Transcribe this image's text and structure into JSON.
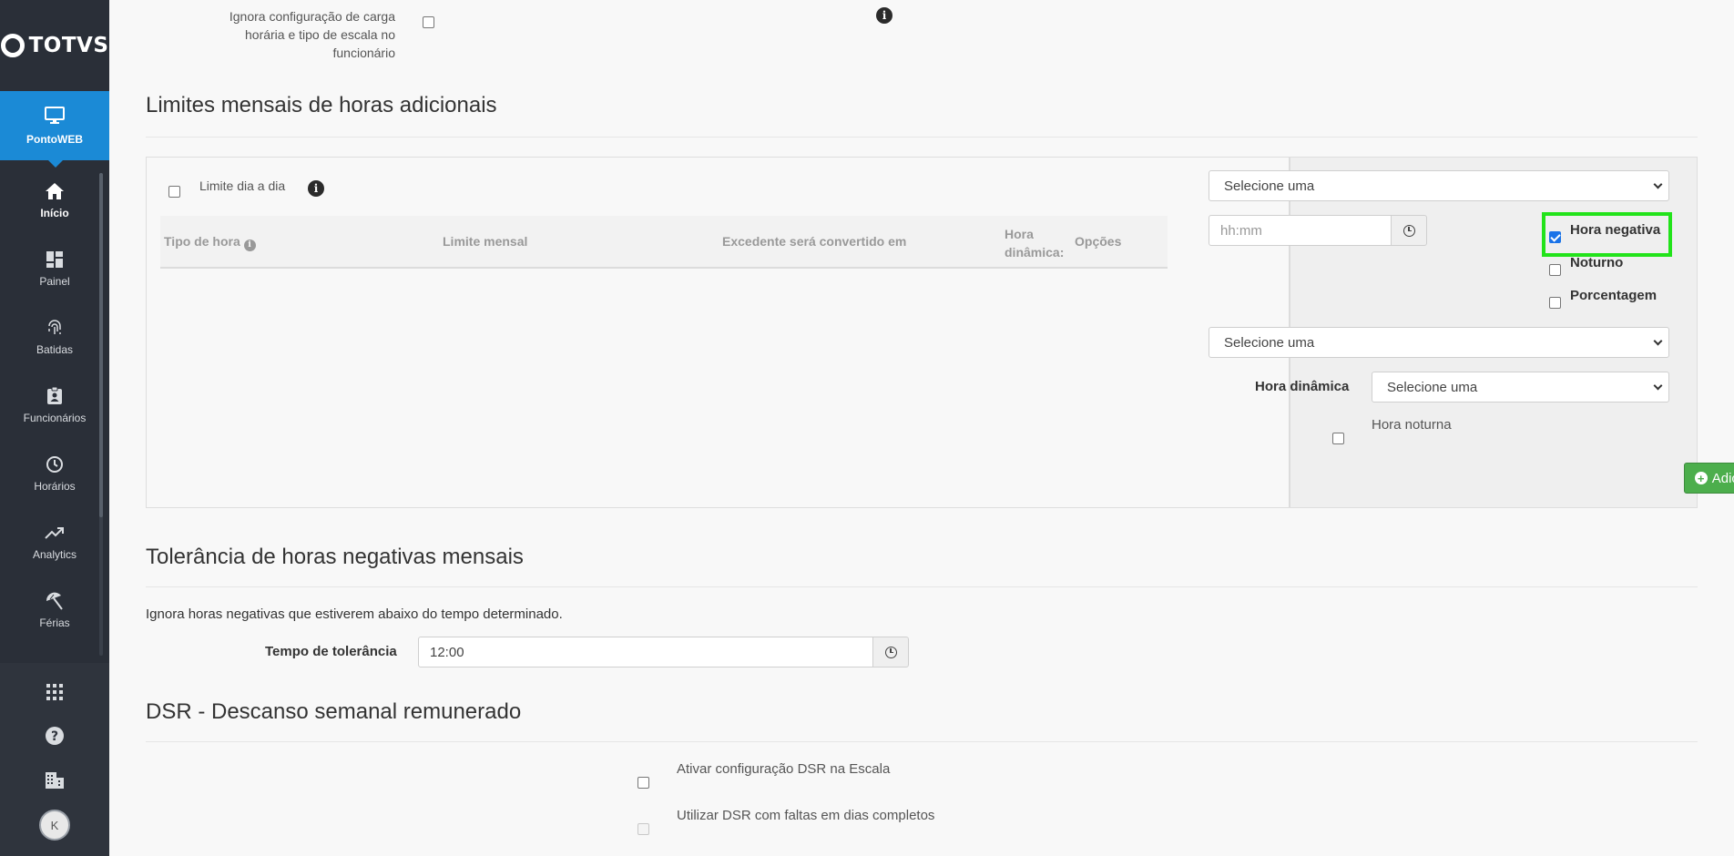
{
  "brand": {
    "logo_text": "TOTVS"
  },
  "sidebar": {
    "module": {
      "label": "PontoWEB",
      "icon": "monitor-icon"
    },
    "items": [
      {
        "label": "Início",
        "icon": "home-icon"
      },
      {
        "label": "Painel",
        "icon": "dashboard-icon"
      },
      {
        "label": "Batidas",
        "icon": "fingerprint-icon"
      },
      {
        "label": "Funcionários",
        "icon": "id-badge-icon"
      },
      {
        "label": "Horários",
        "icon": "clock-icon"
      },
      {
        "label": "Analytics",
        "icon": "trending-up-icon"
      },
      {
        "label": "Férias",
        "icon": "beach-umbrella-icon"
      }
    ],
    "bottom": {
      "apps_icon": "grid-icon",
      "help_icon": "question-icon",
      "company_icon": "building-icon",
      "avatar_initial": "K"
    }
  },
  "top_setting": {
    "label_line1": "Ignora configuração de carga",
    "label_line2": "horária e tipo de escala no",
    "label_line3": "funcionário",
    "checked": false
  },
  "limites": {
    "title": "Limites mensais de horas adicionais",
    "limite_dia_label": "Limite dia a dia",
    "limite_dia_checked": false,
    "table": {
      "col_tipo": "Tipo de hora",
      "col_limite": "Limite mensal",
      "col_excedente": "Excedente será convertido em",
      "col_dinamica_1": "Hora",
      "col_dinamica_2": "dinâmica:",
      "col_opcoes": "Opções",
      "rows": []
    },
    "form": {
      "select1": "Selecione uma",
      "time_placeholder": "hh:mm",
      "hora_negativa_label": "Hora negativa",
      "hora_negativa_checked": true,
      "noturno_label": "Noturno",
      "noturno_checked": false,
      "porcentagem_label": "Porcentagem",
      "porcentagem_checked": false,
      "select2": "Selecione uma",
      "hora_dinamica_label": "Hora dinâmica",
      "hora_dinamica_select": "Selecione uma",
      "hora_noturna_label": "Hora noturna",
      "hora_noturna_checked": false,
      "add_button": "Adicionar"
    }
  },
  "tolerancia": {
    "title": "Tolerância de horas negativas mensais",
    "description": "Ignora horas negativas que estiverem abaixo do tempo determinado.",
    "field_label": "Tempo de tolerância",
    "field_value": "12:00"
  },
  "dsr": {
    "title": "DSR - Descanso semanal remunerado",
    "ativar_label": "Ativar configuração DSR na Escala",
    "ativar_checked": false,
    "utilizar_label": "Utilizar DSR com faltas em dias completos",
    "utilizar_disabled": true
  },
  "colors": {
    "sidebar_bg": "#2a2f38",
    "accent_blue": "#1b8ad6",
    "add_button_green": "#4cae4c",
    "highlight_green": "#22e31a"
  }
}
